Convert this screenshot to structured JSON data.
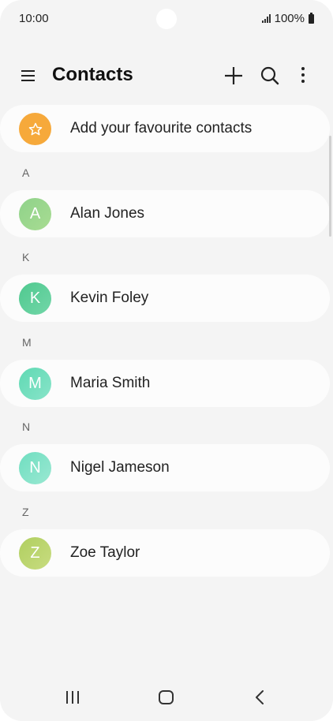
{
  "status_bar": {
    "time": "10:00",
    "battery": "100%"
  },
  "header": {
    "title": "Contacts"
  },
  "favourites": {
    "label": "Add your favourite contacts",
    "color": "#f6a93b"
  },
  "sections": [
    {
      "letter": "A",
      "contact": {
        "initial": "A",
        "name": "Alan Jones",
        "color": "#8fd28a"
      }
    },
    {
      "letter": "K",
      "contact": {
        "initial": "K",
        "name": "Kevin Foley",
        "color": "#5ccf9c"
      }
    },
    {
      "letter": "M",
      "contact": {
        "initial": "M",
        "name": "Maria Smith",
        "color": "#6fdcbe"
      }
    },
    {
      "letter": "N",
      "contact": {
        "initial": "N",
        "name": "Nigel Jameson",
        "color": "#7fe2c6"
      }
    },
    {
      "letter": "Z",
      "contact": {
        "initial": "Z",
        "name": "Zoe Taylor",
        "color": "#b9d46c"
      }
    }
  ],
  "icons": {
    "menu": "menu-icon",
    "add": "plus-icon",
    "search": "search-icon",
    "more": "more-vertical-icon",
    "favourite": "star-icon",
    "recents": "recents-icon",
    "home": "home-icon",
    "back": "back-icon"
  }
}
